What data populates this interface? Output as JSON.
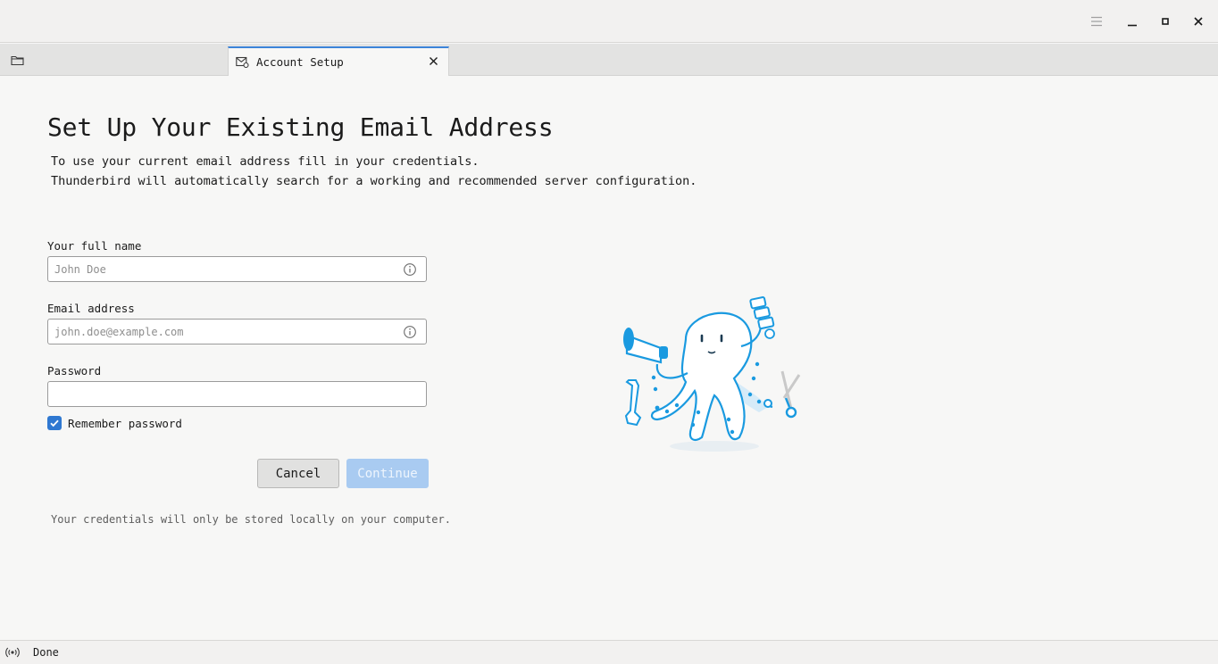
{
  "window": {
    "controls": {
      "menu_icon": "hamburger-icon",
      "minimize_icon": "minimize-icon",
      "maximize_icon": "maximize-icon",
      "close_icon": "close-icon"
    }
  },
  "tabs": {
    "folder_tab_icon": "folder-icon",
    "active_tab": {
      "label": "Account Setup",
      "icon": "mail-settings-icon",
      "close_icon": "close-icon"
    }
  },
  "setup": {
    "title": "Set Up Your Existing Email Address",
    "description_line1": "To use your current email address fill in your credentials.",
    "description_line2": "Thunderbird will automatically search for a working and recommended server configuration.",
    "full_name": {
      "label": "Your full name",
      "placeholder": "John Doe",
      "value": ""
    },
    "email": {
      "label": "Email address",
      "placeholder": "john.doe@example.com",
      "value": ""
    },
    "password": {
      "label": "Password",
      "value": ""
    },
    "remember_password": {
      "label": "Remember password",
      "checked": true
    },
    "buttons": {
      "cancel": "Cancel",
      "continue": "Continue"
    },
    "note": "Your credentials will only be stored locally on your computer."
  },
  "statusbar": {
    "text": "Done",
    "icon": "online-status-icon"
  },
  "colors": {
    "accent": "#2f78d1",
    "continue_disabled": "#a9cbf1",
    "mascot_blue": "#1a9ae0"
  }
}
